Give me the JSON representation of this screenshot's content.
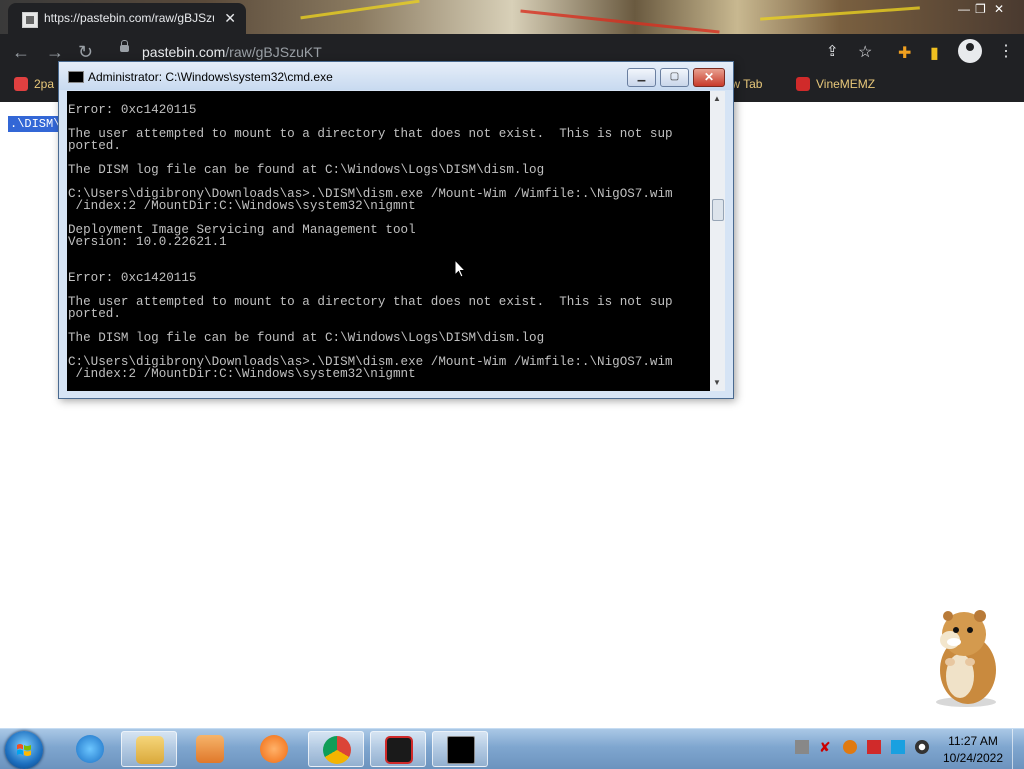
{
  "browser": {
    "tab_title": "https://pastebin.com/raw/gBJSzu",
    "tab_close": "✕",
    "url_host": "pastebin.com",
    "url_path": "/raw/gBJSzuKT",
    "window_controls": {
      "minimize": "—",
      "restore": "❐",
      "close": "✕"
    },
    "bookmarks": [
      {
        "label": "2pa",
        "icon": "bookmark-icon"
      },
      {
        "label": "New Tab",
        "icon": "new-tab-icon"
      },
      {
        "label": "VineMEMZ",
        "icon": "vinememz-icon"
      }
    ]
  },
  "page": {
    "raw_text": ".\\DISM\\"
  },
  "cmd": {
    "title": "Administrator: C:\\Windows\\system32\\cmd.exe",
    "lines": "\nError: 0xc1420115\n\nThe user attempted to mount to a directory that does not exist.  This is not sup\nported.\n\nThe DISM log file can be found at C:\\Windows\\Logs\\DISM\\dism.log\n\nC:\\Users\\digibrony\\Downloads\\as>.\\DISM\\dism.exe /Mount-Wim /Wimfile:.\\NigOS7.wim\n /index:2 /MountDir:C:\\Windows\\system32\\nigmnt\n\nDeployment Image Servicing and Management tool\nVersion: 10.0.22621.1\n\n\nError: 0xc1420115\n\nThe user attempted to mount to a directory that does not exist.  This is not sup\nported.\n\nThe DISM log file can be found at C:\\Windows\\Logs\\DISM\\dism.log\n\nC:\\Users\\digibrony\\Downloads\\as>.\\DISM\\dism.exe /Mount-Wim /Wimfile:.\\NigOS7.wim\n /index:2 /MountDir:C:\\Windows\\system32\\nigmnt"
  },
  "taskbar": {
    "apps": [
      "start-button",
      "internet-explorer",
      "file-explorer",
      "media-player",
      "uc-browser",
      "chrome",
      "screen-recorder",
      "command-prompt"
    ],
    "clock_time": "11:27 AM",
    "clock_date": "10/24/2022"
  },
  "colors": {
    "chrome_dark": "#202124",
    "bookmark_text": "#e8c87a",
    "selection": "#3367d6",
    "console_bg": "#000000",
    "console_text": "#c0c0c0"
  }
}
